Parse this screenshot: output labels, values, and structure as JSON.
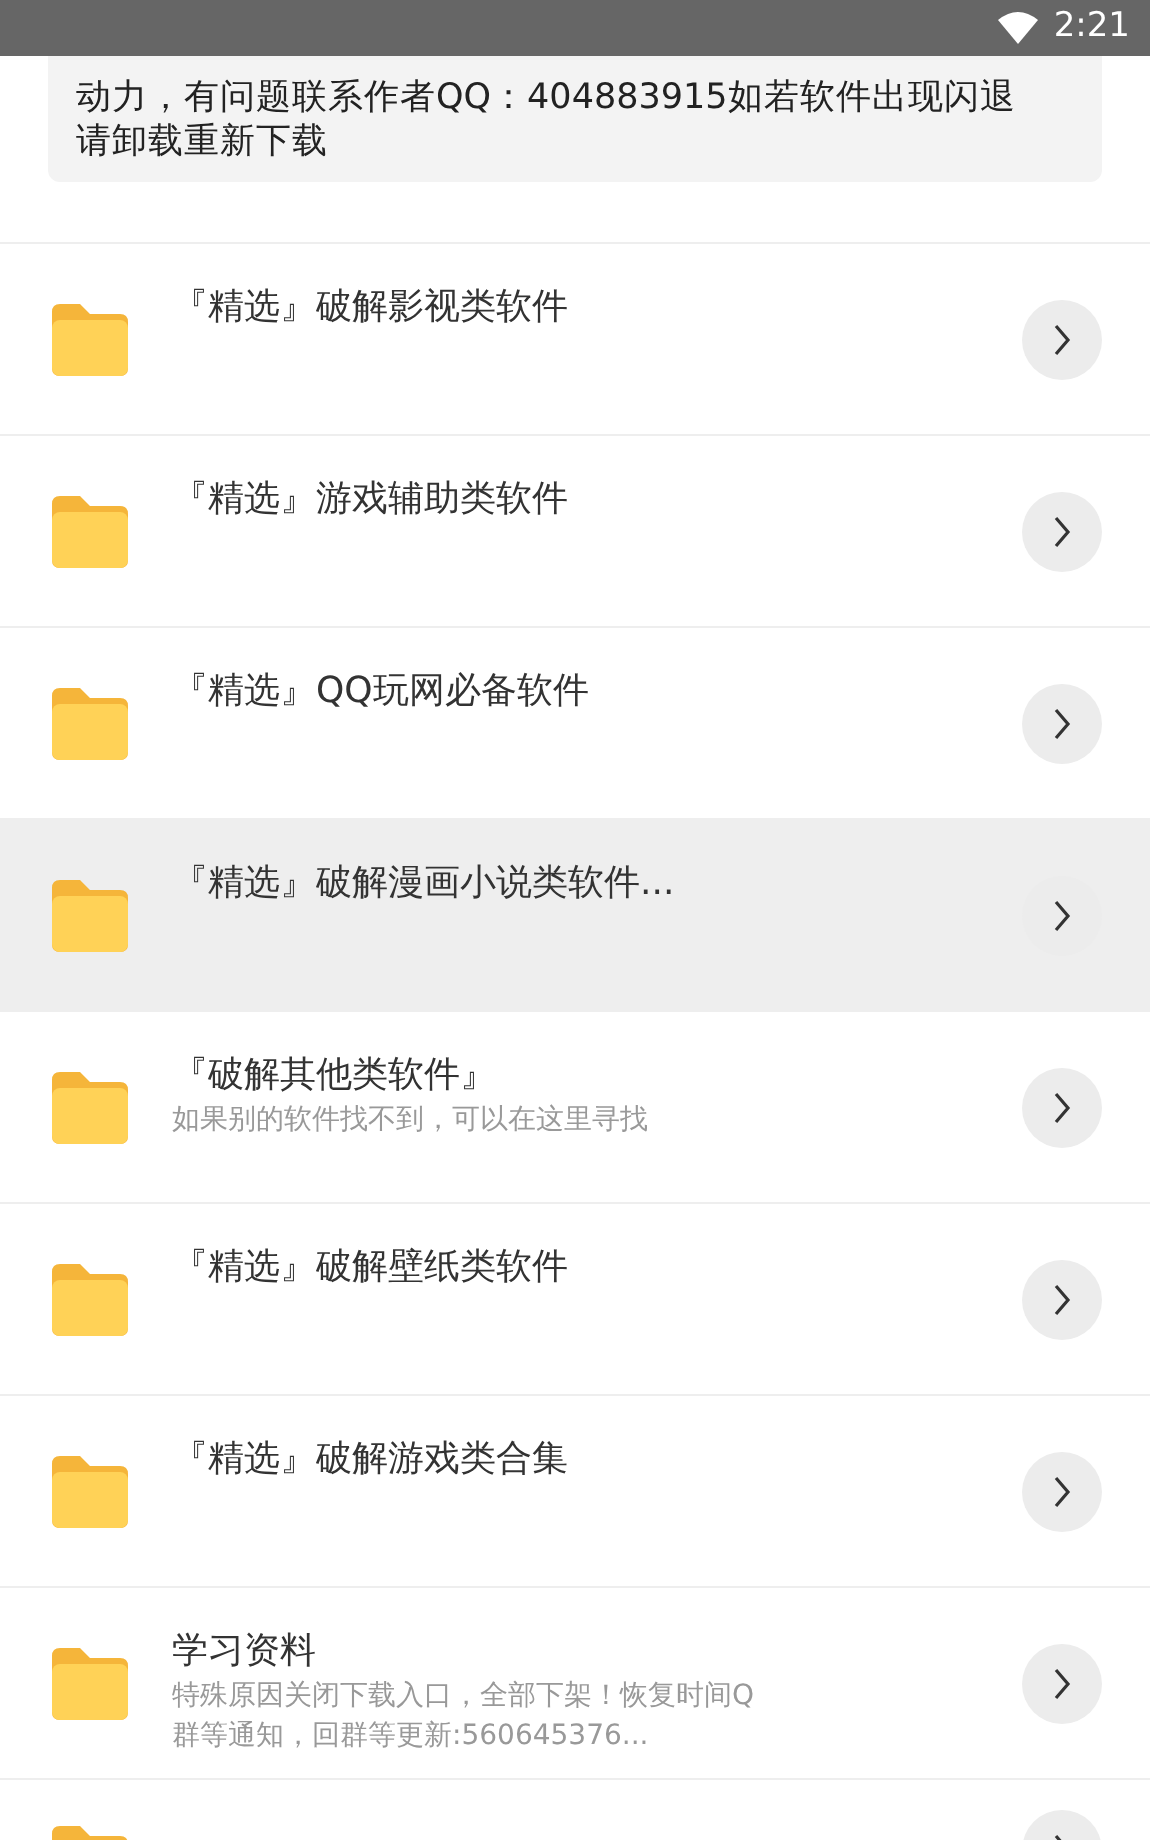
{
  "status_bar": {
    "time": "2:21"
  },
  "notice": {
    "lines": [
      "动力，有问题联系作者QQ：404883915如若软件出现闪退",
      "请卸载重新下载"
    ]
  },
  "rows": [
    {
      "title": "『精选』破解影视类软件",
      "selected": false
    },
    {
      "title": "『精选』游戏辅助类软件",
      "selected": false
    },
    {
      "title": "『精选』QQ玩网必备软件",
      "selected": false
    },
    {
      "title": "『精选』破解漫画小说类软件...",
      "selected": true
    },
    {
      "title": "『破解其他类软件』",
      "subtitle": "如果别的软件找不到，可以在这里寻找",
      "selected": false
    },
    {
      "title": "『精选』破解壁纸类软件",
      "selected": false
    },
    {
      "title": "『精选』破解游戏类合集",
      "selected": false
    },
    {
      "title": "学习资料",
      "subtitle": "特殊原因关闭下载入口，全部下架！恢复时间Q\n群等通知，回群等更新:560645376...",
      "selected": false
    },
    {
      "selected": false
    }
  ]
}
